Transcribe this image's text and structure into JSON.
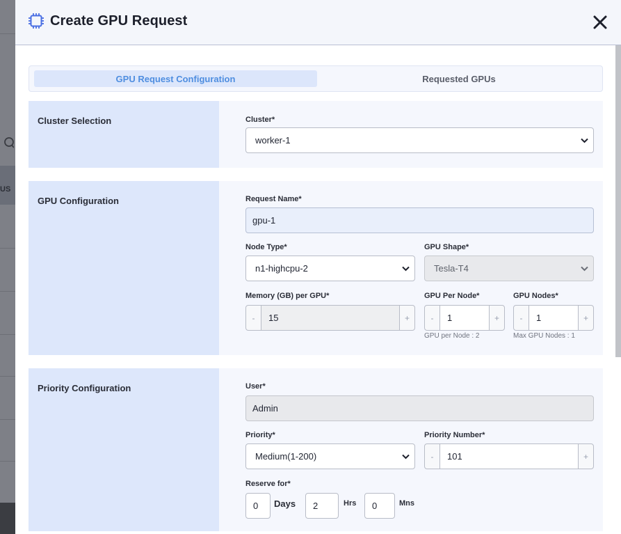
{
  "backdrop": {
    "fragment_text": "US"
  },
  "modal": {
    "title": "Create GPU Request",
    "icons": {
      "title": "chip-icon",
      "close": "close-icon"
    }
  },
  "tabs": [
    {
      "label": "GPU Request Configuration",
      "active": true
    },
    {
      "label": "Requested GPUs",
      "active": false
    }
  ],
  "cluster_section": {
    "title": "Cluster Selection",
    "cluster_label": "Cluster*",
    "cluster_value": "worker-1"
  },
  "gpu_section": {
    "title": "GPU Configuration",
    "request_name_label": "Request Name*",
    "request_name_value": "gpu-1",
    "node_type_label": "Node Type*",
    "node_type_value": "n1-highcpu-2",
    "gpu_shape_label": "GPU Shape*",
    "gpu_shape_value": "Tesla-T4",
    "memory_label": "Memory (GB) per GPU*",
    "memory_value": "15",
    "gpu_per_node_label": "GPU Per Node*",
    "gpu_per_node_value": "1",
    "gpu_per_node_hint": "GPU per Node : 2",
    "gpu_nodes_label": "GPU Nodes*",
    "gpu_nodes_value": "1",
    "gpu_nodes_hint": "Max GPU Nodes : 1",
    "minus": "-",
    "plus": "+"
  },
  "priority_section": {
    "title": "Priority Configuration",
    "user_label": "User*",
    "user_value": "Admin",
    "priority_label": "Priority*",
    "priority_value": "Medium(1-200)",
    "priority_number_label": "Priority Number*",
    "priority_number_value": "101",
    "reserve_label": "Reserve for*",
    "days_value": "0",
    "days_unit": "Days",
    "hrs_value": "2",
    "hrs_unit": "Hrs",
    "mns_value": "0",
    "mns_unit": "Mns"
  },
  "colors": {
    "accent": "#4f8ee0",
    "section_left": "#dde7fb",
    "section_bg": "#f5f7fd"
  }
}
